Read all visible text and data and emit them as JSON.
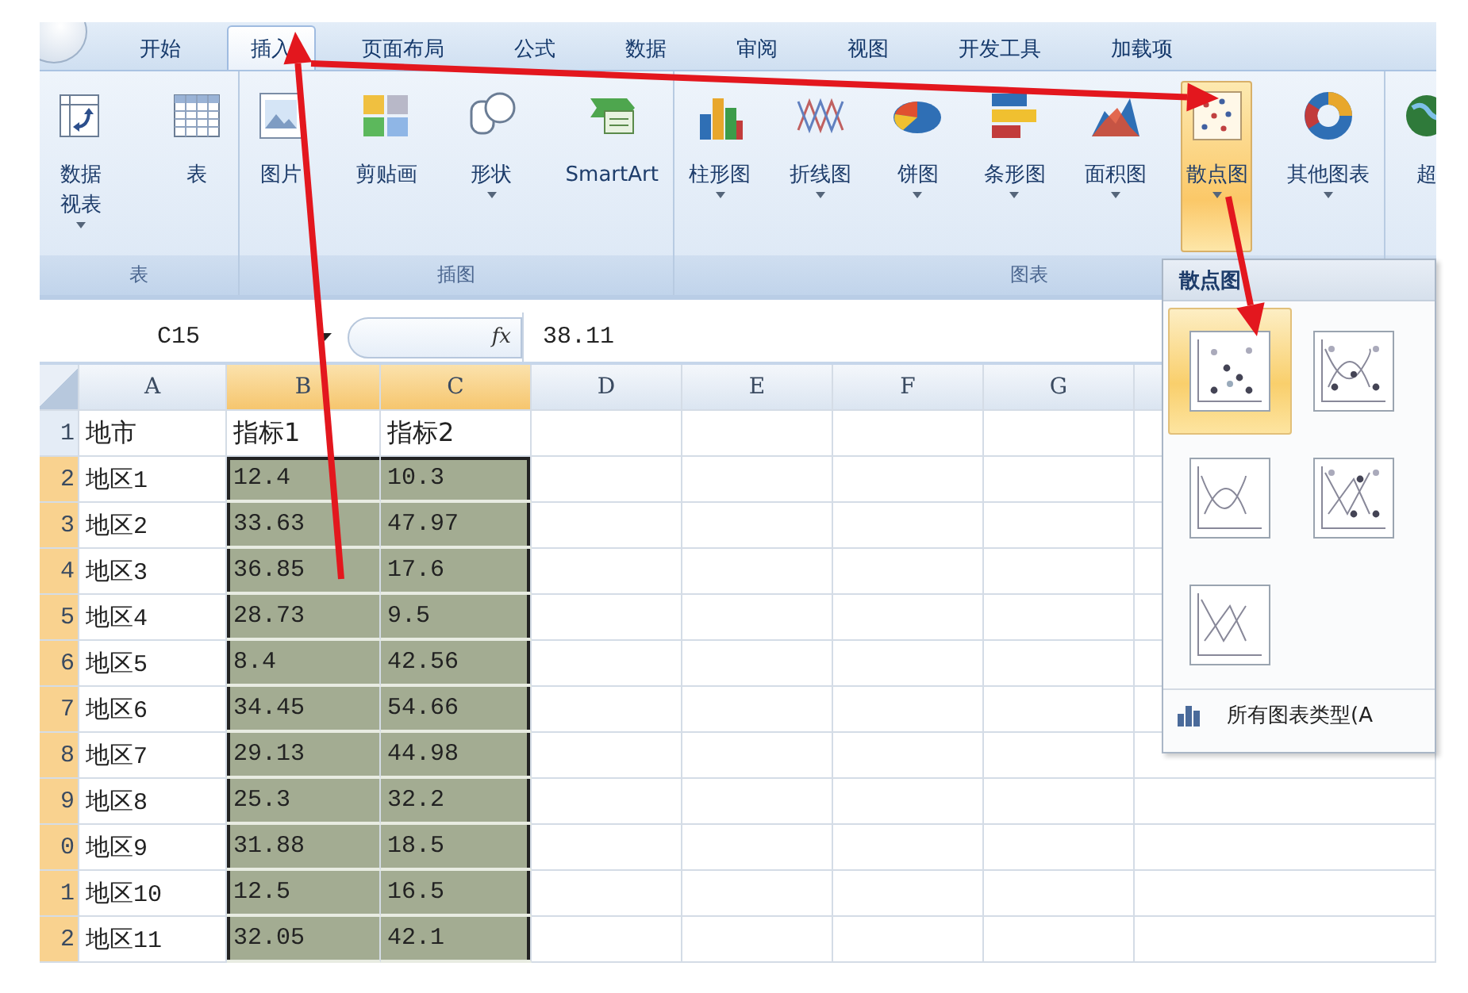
{
  "tabs": [
    {
      "label": "开始",
      "selected": false
    },
    {
      "label": "插入",
      "selected": true
    },
    {
      "label": "页面布局",
      "selected": false
    },
    {
      "label": "公式",
      "selected": false
    },
    {
      "label": "数据",
      "selected": false
    },
    {
      "label": "审阅",
      "selected": false
    },
    {
      "label": "视图",
      "selected": false
    },
    {
      "label": "开发工具",
      "selected": false
    },
    {
      "label": "加载项",
      "selected": false
    }
  ],
  "ribbon": {
    "groups": [
      {
        "label": "表",
        "buttons": [
          {
            "kind": "pivot",
            "lines": [
              "数据",
              "视表"
            ],
            "dropdown": true,
            "selected": false
          },
          {
            "kind": "table",
            "lines": [
              "表"
            ],
            "dropdown": false,
            "selected": false
          }
        ]
      },
      {
        "label": "插图",
        "buttons": [
          {
            "kind": "picture",
            "lines": [
              "图片"
            ],
            "dropdown": false,
            "selected": false
          },
          {
            "kind": "clipart",
            "lines": [
              "剪贴画"
            ],
            "dropdown": false,
            "selected": false
          },
          {
            "kind": "shapes",
            "lines": [
              "形状"
            ],
            "dropdown": true,
            "selected": false
          },
          {
            "kind": "smartart",
            "lines": [
              "SmartArt"
            ],
            "dropdown": false,
            "selected": false
          }
        ]
      },
      {
        "label": "图表",
        "buttons": [
          {
            "kind": "column",
            "lines": [
              "柱形图"
            ],
            "dropdown": true,
            "selected": false
          },
          {
            "kind": "line",
            "lines": [
              "折线图"
            ],
            "dropdown": true,
            "selected": false
          },
          {
            "kind": "pie",
            "lines": [
              "饼图"
            ],
            "dropdown": true,
            "selected": false
          },
          {
            "kind": "bar",
            "lines": [
              "条形图"
            ],
            "dropdown": true,
            "selected": false
          },
          {
            "kind": "area",
            "lines": [
              "面积图"
            ],
            "dropdown": true,
            "selected": false
          },
          {
            "kind": "scatter",
            "lines": [
              "散点图"
            ],
            "dropdown": true,
            "selected": true
          },
          {
            "kind": "other",
            "lines": [
              "其他图表"
            ],
            "dropdown": true,
            "selected": false
          }
        ]
      },
      {
        "buttons": [
          {
            "kind": "globe",
            "lines": [
              "超"
            ],
            "dropdown": false,
            "selected": false
          }
        ]
      }
    ]
  },
  "formula_bar": {
    "name_box": "C15",
    "function_label": "fx",
    "value": "38.11"
  },
  "sheet": {
    "columns": [
      {
        "label": "A",
        "selected": false
      },
      {
        "label": "B",
        "selected": true
      },
      {
        "label": "C",
        "selected": true
      },
      {
        "label": "D",
        "selected": false
      },
      {
        "label": "E",
        "selected": false
      },
      {
        "label": "F",
        "selected": false
      },
      {
        "label": "G",
        "selected": false
      }
    ],
    "rows": [
      {
        "number": "1",
        "selected": false,
        "cells": [
          "地市",
          "指标1",
          "指标2"
        ]
      },
      {
        "number": "2",
        "selected": true,
        "cells": [
          "地区1",
          "12.4",
          "10.3"
        ]
      },
      {
        "number": "3",
        "selected": true,
        "cells": [
          "地区2",
          "33.63",
          "47.97"
        ]
      },
      {
        "number": "4",
        "selected": true,
        "cells": [
          "地区3",
          "36.85",
          "17.6"
        ]
      },
      {
        "number": "5",
        "selected": true,
        "cells": [
          "地区4",
          "28.73",
          "9.5"
        ]
      },
      {
        "number": "6",
        "selected": true,
        "cells": [
          "地区5",
          "8.4",
          "42.56"
        ]
      },
      {
        "number": "7",
        "selected": true,
        "cells": [
          "地区6",
          "34.45",
          "54.66"
        ]
      },
      {
        "number": "8",
        "selected": true,
        "cells": [
          "地区7",
          "29.13",
          "44.98"
        ]
      },
      {
        "number": "9",
        "selected": true,
        "cells": [
          "地区8",
          "25.3",
          "32.2"
        ]
      },
      {
        "number": "0",
        "selected": true,
        "cells": [
          "地区9",
          "31.88",
          "18.5"
        ]
      },
      {
        "number": "1",
        "selected": true,
        "cells": [
          "地区10",
          "12.5",
          "16.5"
        ]
      },
      {
        "number": "2",
        "selected": true,
        "cells": [
          "地区11",
          "32.05",
          "42.1"
        ]
      }
    ]
  },
  "gallery": {
    "title": "散点图",
    "options": [
      {
        "kind": "markers",
        "selected": true
      },
      {
        "kind": "smooth-markers",
        "selected": false
      },
      {
        "kind": "smooth-lines",
        "selected": false
      },
      {
        "kind": "straight-markers",
        "selected": false
      },
      {
        "kind": "straight-lines",
        "selected": false
      }
    ],
    "footer": "所有图表类型(A"
  }
}
